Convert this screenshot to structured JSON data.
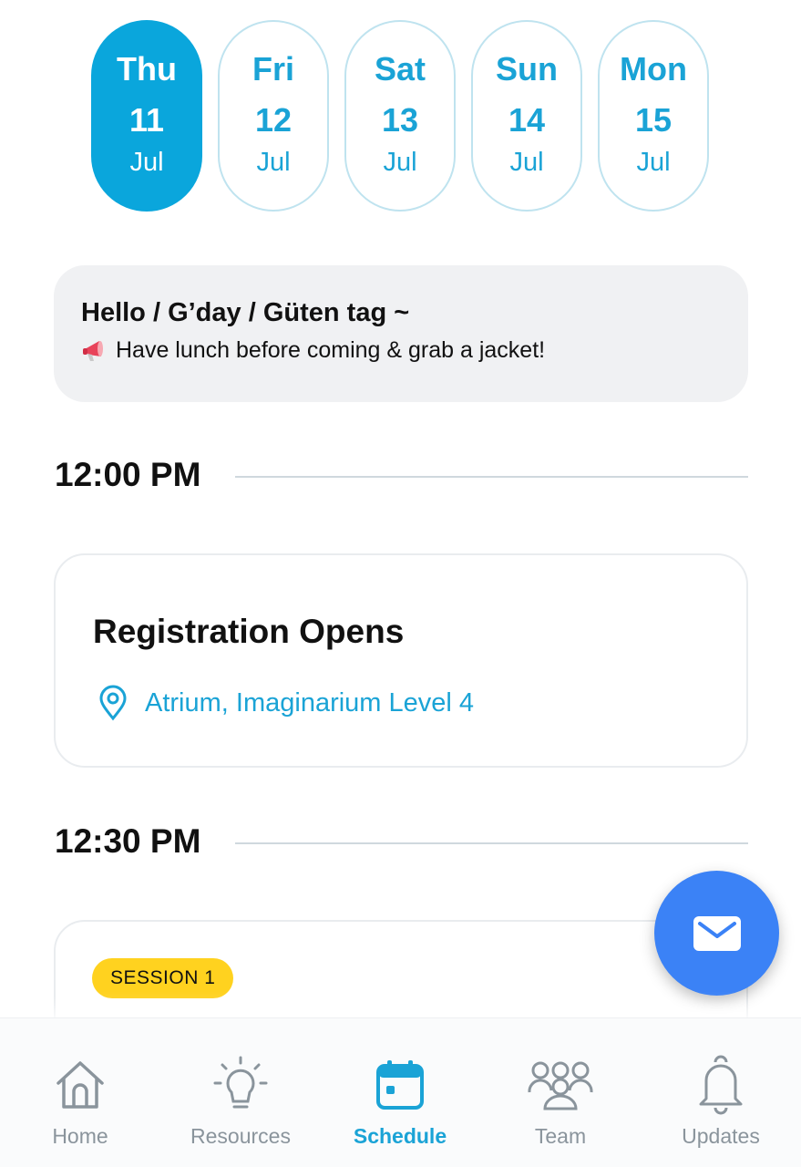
{
  "dates": [
    {
      "dow": "Thu",
      "day": "11",
      "mon": "Jul",
      "active": true
    },
    {
      "dow": "Fri",
      "day": "12",
      "mon": "Jul",
      "active": false
    },
    {
      "dow": "Sat",
      "day": "13",
      "mon": "Jul",
      "active": false
    },
    {
      "dow": "Sun",
      "day": "14",
      "mon": "Jul",
      "active": false
    },
    {
      "dow": "Mon",
      "day": "15",
      "mon": "Jul",
      "active": false
    }
  ],
  "announcement": {
    "title": "Hello / G’day / Güten tag ~",
    "message": "Have lunch before coming & grab a jacket!",
    "icon": "megaphone-icon"
  },
  "schedule": [
    {
      "time": "12:00 PM",
      "event": {
        "title": "Registration Opens",
        "location": "Atrium, Imaginarium Level 4",
        "icon": "location-pin-icon"
      }
    },
    {
      "time": "12:30 PM",
      "event": {
        "badge": "SESSION 1"
      }
    }
  ],
  "fab": {
    "icon": "mail-icon"
  },
  "nav": {
    "items": [
      {
        "label": "Home",
        "icon": "home-icon"
      },
      {
        "label": "Resources",
        "icon": "lightbulb-icon"
      },
      {
        "label": "Schedule",
        "icon": "calendar-icon",
        "active": true
      },
      {
        "label": "Team",
        "icon": "team-icon"
      },
      {
        "label": "Updates",
        "icon": "bell-icon"
      }
    ]
  },
  "colors": {
    "accent": "#0aa6dc",
    "fab": "#3b82f6",
    "badge": "#ffd21f",
    "nav_inactive": "#8a949c"
  }
}
